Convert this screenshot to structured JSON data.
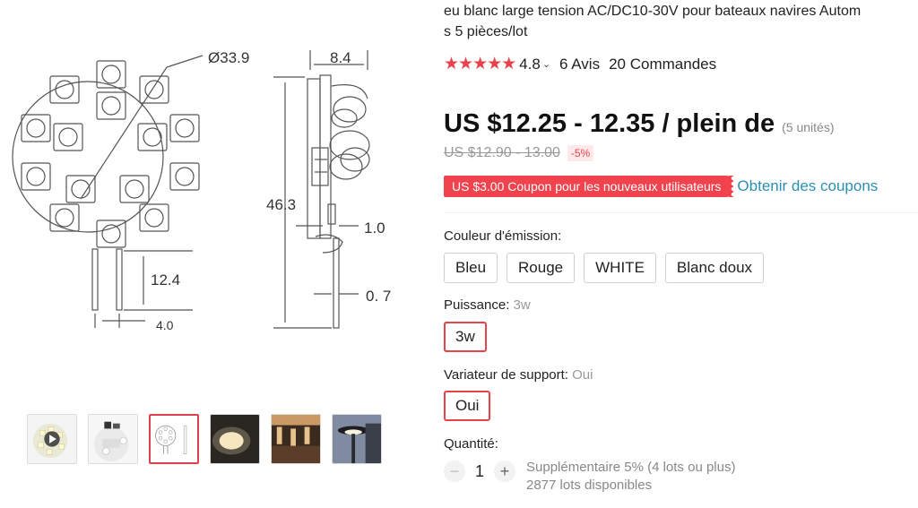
{
  "product": {
    "title_line1": "eu blanc large tension AC/DC10-30V pour bateaux navires Autom",
    "title_line2": "s 5 pièces/lot",
    "stars": "★★★★★",
    "rating": "4.8",
    "reviews": "6 Avis",
    "orders": "20 Commandes",
    "price": "US $12.25 - 12.35 / plein de",
    "price_units": "(5 unités)",
    "old_price": "US $12.90 - 13.00",
    "discount": "-5%",
    "coupon": "US $3.00 Coupon pour les nouveaux utilisateurs",
    "get_coupons": "Obtenir des coupons"
  },
  "diagram": {
    "diameter": "Ø33.9",
    "depth": "8.4",
    "height": "46.3",
    "pin_length": "12.4",
    "pin_spacing": "4.0",
    "pin_offset": "1.0",
    "pin_thickness": "0. 7"
  },
  "options": {
    "color_label": "Couleur d'émission:",
    "colors": [
      "Bleu",
      "Rouge",
      "WHITE",
      "Blanc doux"
    ],
    "power_label": "Puissance: ",
    "power_selected": "3w",
    "power_options": [
      "3w"
    ],
    "dimmer_label": "Variateur de support: ",
    "dimmer_selected": "Oui",
    "dimmer_options": [
      "Oui"
    ],
    "quantity_label": "Quantité:",
    "quantity": "1",
    "minus": "−",
    "plus": "+",
    "bulk_info": "Supplémentaire 5% (4 lots ou plus)",
    "available": "2877 lots disponibles"
  },
  "icons": {
    "play": "play-icon",
    "star": "star-icon",
    "chevron": "chevron-down-icon"
  },
  "colors": {
    "accent": "#e8434b",
    "coupon_bg": "#f0434d",
    "link": "#2b8fb1"
  }
}
